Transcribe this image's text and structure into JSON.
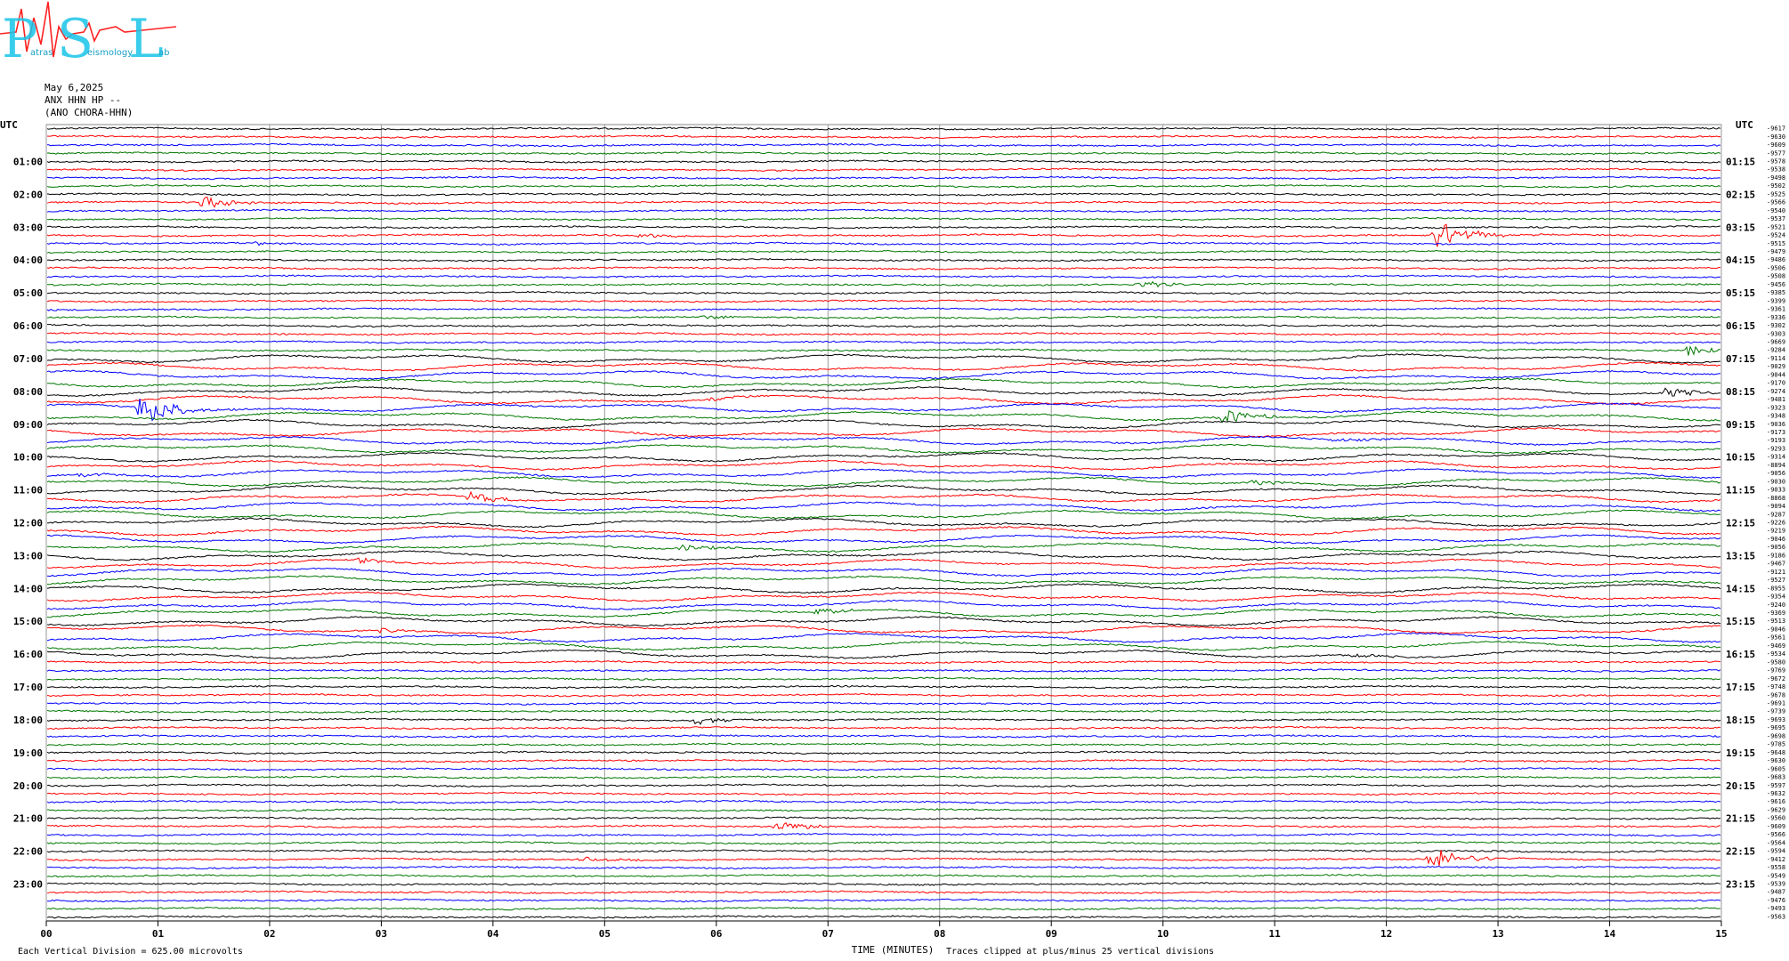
{
  "header": {
    "date": "May 6,2025",
    "station": "ANX HHN HP --",
    "network": "(ANO CHORA-HHN)"
  },
  "logo": {
    "letters": [
      "P",
      "S",
      "L"
    ],
    "words": [
      "atras",
      "eismology",
      "ab"
    ]
  },
  "footer": {
    "scale_note": "Each Vertical Division =  625.00 microvolts",
    "clip_note": "Traces clipped at plus/minus 25 vertical divisions"
  },
  "chart_data": {
    "type": "line",
    "title": "",
    "xlabel": "TIME (MINUTES)",
    "ylabel": "UTC",
    "right_axis_label": "UTC",
    "x_ticks": [
      "00",
      "01",
      "02",
      "03",
      "04",
      "05",
      "06",
      "07",
      "08",
      "09",
      "10",
      "11",
      "12",
      "13",
      "14",
      "15"
    ],
    "xlim": [
      0,
      15
    ],
    "grid": true,
    "trace_colors": [
      "#000000",
      "#ff0000",
      "#0000ff",
      "#007700"
    ],
    "left_hour_labels": [
      "01:00",
      "02:00",
      "03:00",
      "04:00",
      "05:00",
      "06:00",
      "07:00",
      "08:00",
      "09:00",
      "10:00",
      "11:00",
      "12:00",
      "13:00",
      "14:00",
      "15:00",
      "16:00",
      "17:00",
      "18:00",
      "19:00",
      "20:00",
      "21:00",
      "22:00",
      "23:00"
    ],
    "right_hour_labels": [
      "01:15",
      "02:15",
      "03:15",
      "04:15",
      "05:15",
      "06:15",
      "07:15",
      "08:15",
      "09:15",
      "10:15",
      "11:15",
      "12:15",
      "13:15",
      "14:15",
      "15:15",
      "16:15",
      "17:15",
      "18:15",
      "19:15",
      "20:15",
      "21:15",
      "22:15",
      "23:15"
    ],
    "row_offsets": [
      "-9617",
      "-9630",
      "-9609",
      "-9577",
      "-9578",
      "-9538",
      "-9498",
      "-9502",
      "-9525",
      "-9566",
      "-9540",
      "-9537",
      "-9521",
      "-9524",
      "-9515",
      "-9479",
      "-9486",
      "-9506",
      "-9508",
      "-9456",
      "-9385",
      "-9399",
      "-9361",
      "-9336",
      "-9302",
      "-9303",
      "-9669",
      "-9284",
      "-9114",
      "-9029",
      "-9044",
      "-9170",
      "-9274",
      "-9481",
      "-9323",
      "-9348",
      "-9036",
      "-9173",
      "-9193",
      "-9293",
      "-9314",
      "-8894",
      "-9056",
      "-9030",
      "-9033",
      "-8868",
      "-9094",
      "-9287",
      "-9226",
      "-9219",
      "-9046",
      "-9056",
      "-9186",
      "-9467",
      "-9121",
      "-9527",
      "-8955",
      "-9354",
      "-9240",
      "-9369",
      "-9513",
      "-9046",
      "-9561",
      "-9469",
      "-9534",
      "-9580",
      "-9769",
      "-9672",
      "-9748",
      "-9678",
      "-9691",
      "-9739",
      "-9693",
      "-9695",
      "-9698",
      "-9785",
      "-9648",
      "-9630",
      "-9605",
      "-9683",
      "-9597",
      "-9632",
      "-9616",
      "-9629",
      "-9560",
      "-9609",
      "-9566",
      "-9564",
      "-9594",
      "-9412",
      "-9558",
      "-9549",
      "-9539",
      "-9487",
      "-9476",
      "-9493",
      "-9563"
    ],
    "events": [
      {
        "row": 9,
        "minute": 1.4,
        "amplitude": 7
      },
      {
        "row": 13,
        "minute": 5.3,
        "amplitude": 3
      },
      {
        "row": 13,
        "minute": 12.45,
        "amplitude": 18
      },
      {
        "row": 14,
        "minute": 1.9,
        "amplitude": 2
      },
      {
        "row": 19,
        "minute": 9.8,
        "amplitude": 4
      },
      {
        "row": 23,
        "minute": 5.9,
        "amplitude": 3
      },
      {
        "row": 27,
        "minute": 14.7,
        "amplitude": 6
      },
      {
        "row": 32,
        "minute": 14.5,
        "amplitude": 6
      },
      {
        "row": 34,
        "minute": 0.85,
        "amplitude": 22
      },
      {
        "row": 33,
        "minute": 5.95,
        "amplitude": 3
      },
      {
        "row": 35,
        "minute": 10.5,
        "amplitude": 10
      },
      {
        "row": 38,
        "minute": 11.5,
        "amplitude": 3
      },
      {
        "row": 42,
        "minute": 0.3,
        "amplitude": 3
      },
      {
        "row": 45,
        "minute": 3.8,
        "amplitude": 6
      },
      {
        "row": 43,
        "minute": 10.8,
        "amplitude": 3
      },
      {
        "row": 51,
        "minute": 5.7,
        "amplitude": 4
      },
      {
        "row": 53,
        "minute": 2.8,
        "amplitude": 3
      },
      {
        "row": 59,
        "minute": 6.9,
        "amplitude": 4
      },
      {
        "row": 61,
        "minute": 3.0,
        "amplitude": 3
      },
      {
        "row": 64,
        "minute": 11.7,
        "amplitude": 3
      },
      {
        "row": 72,
        "minute": 5.8,
        "amplitude": 5
      },
      {
        "row": 85,
        "minute": 6.55,
        "amplitude": 6
      },
      {
        "row": 89,
        "minute": 4.8,
        "amplitude": 3
      },
      {
        "row": 89,
        "minute": 12.4,
        "amplitude": 14
      }
    ]
  }
}
